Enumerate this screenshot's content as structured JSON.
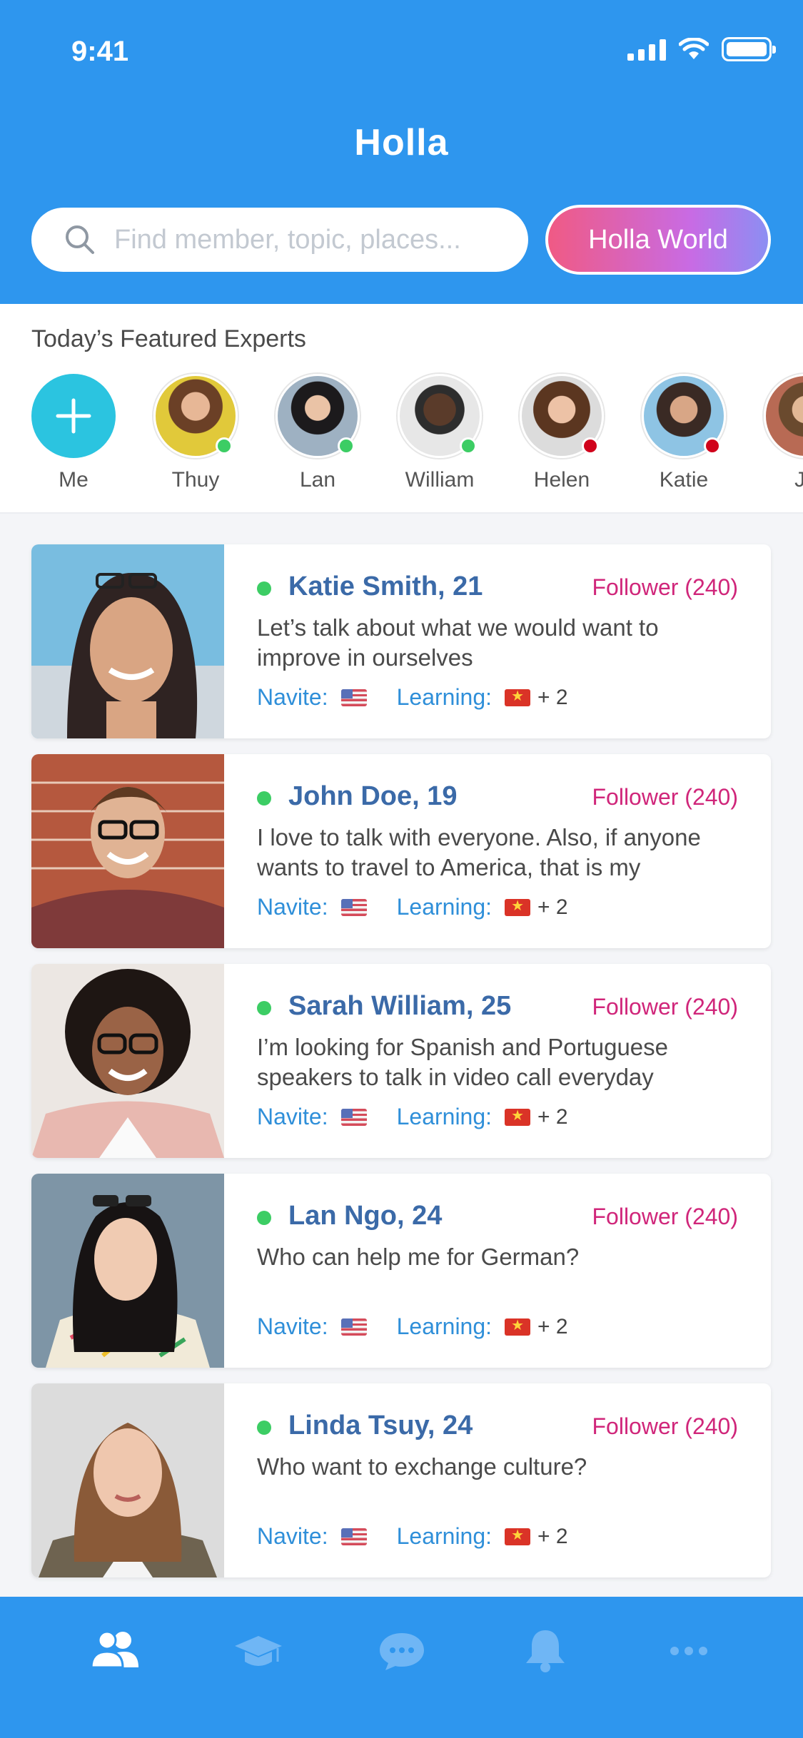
{
  "status_bar": {
    "time": "9:41"
  },
  "header": {
    "logo": "Holla",
    "search": {
      "placeholder": "Find member, topic, places..."
    },
    "world_button": "Holla World"
  },
  "featured": {
    "title": "Today’s Featured Experts",
    "items": [
      {
        "name": "Me",
        "status": "add"
      },
      {
        "name": "Thuy",
        "status": "online"
      },
      {
        "name": "Lan",
        "status": "online"
      },
      {
        "name": "William",
        "status": "online"
      },
      {
        "name": "Helen",
        "status": "busy"
      },
      {
        "name": "Katie",
        "status": "busy"
      },
      {
        "name": "Jo",
        "status": "online"
      }
    ]
  },
  "members": [
    {
      "name": "Katie Smith, 21",
      "followers": "Follower (240)",
      "bio": "Let’s talk about what we would want to improve in ourselves",
      "native_label": "Navite:",
      "learning_label": "Learning:",
      "extra": "+ 2"
    },
    {
      "name": "John Doe, 19",
      "followers": "Follower (240)",
      "bio": "I love to talk with everyone. Also, if anyone wants to travel to America, that is my",
      "native_label": "Navite:",
      "learning_label": "Learning:",
      "extra": "+ 2"
    },
    {
      "name": "Sarah William, 25",
      "followers": "Follower (240)",
      "bio": "I’m looking for Spanish and Portuguese speakers to talk in video call everyday",
      "native_label": "Navite:",
      "learning_label": "Learning:",
      "extra": "+ 2"
    },
    {
      "name": "Lan Ngo, 24",
      "followers": "Follower (240)",
      "bio": "Who can help me for German?",
      "native_label": "Navite:",
      "learning_label": "Learning:",
      "extra": "+ 2"
    },
    {
      "name": "Linda Tsuy, 24",
      "followers": "Follower (240)",
      "bio": "Who want to exchange culture?",
      "native_label": "Navite:",
      "learning_label": "Learning:",
      "extra": "+ 2"
    }
  ],
  "tabbar": {
    "items": [
      {
        "icon": "members-icon",
        "active": true
      },
      {
        "icon": "graduation-cap-icon",
        "active": false
      },
      {
        "icon": "chat-icon",
        "active": false
      },
      {
        "icon": "bell-icon",
        "active": false
      },
      {
        "icon": "more-icon",
        "active": false
      }
    ]
  },
  "colors": {
    "primary": "#2e96ee",
    "online": "#3ccd64",
    "busy": "#d0021b",
    "follower": "#d0267a",
    "name": "#3b6aa8"
  }
}
